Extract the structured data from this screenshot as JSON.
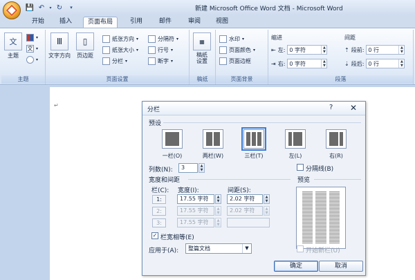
{
  "window": {
    "title": "新建 Microsoft Office Word 文档 - Microsoft Word"
  },
  "qat": {
    "icons": [
      "office-button-icon",
      "save-icon",
      "undo-icon",
      "redo-icon",
      "customize-qat-icon"
    ]
  },
  "tabs": [
    {
      "label": "开始",
      "active": false
    },
    {
      "label": "插入",
      "active": false
    },
    {
      "label": "页面布局",
      "active": true
    },
    {
      "label": "引用",
      "active": false
    },
    {
      "label": "邮件",
      "active": false
    },
    {
      "label": "审阅",
      "active": false
    },
    {
      "label": "视图",
      "active": false
    }
  ],
  "ribbon": {
    "theme_group": {
      "label": "主题",
      "theme_btn": "主题",
      "colors_icon": "■",
      "fonts_icon": "文",
      "effects_icon": "◉"
    },
    "page_setup": {
      "label": "页面设置",
      "text_direction": "文字方向",
      "margins": "页边距",
      "orientation": "纸张方向",
      "size": "纸张大小",
      "columns": "分栏",
      "breaks": "分隔符",
      "line_numbers": "行号",
      "hyphenation": "断字"
    },
    "manuscript": {
      "label": "稿纸",
      "btn": "稿纸\n设置"
    },
    "page_background": {
      "label": "页面背景",
      "watermark": "水印",
      "page_color": "页面颜色",
      "page_borders": "页面边框"
    },
    "paragraph": {
      "label": "段落",
      "indent_title": "缩进",
      "spacing_title": "间距",
      "indent_left_label": "左:",
      "indent_left_value": "0 字符",
      "indent_right_label": "右:",
      "indent_right_value": "0 字符",
      "spacing_before_label": "段前:",
      "spacing_before_value": "0 行",
      "spacing_after_label": "段后:",
      "spacing_after_value": "0 行"
    }
  },
  "dialog": {
    "title": "分栏",
    "help": "?",
    "close": "✕",
    "presets_label": "预设",
    "presets": [
      {
        "label": "一栏(O)",
        "cols": 1,
        "selected": false
      },
      {
        "label": "两栏(W)",
        "cols": 2,
        "selected": false
      },
      {
        "label": "三栏(T)",
        "cols": 3,
        "selected": true
      },
      {
        "label": "左(L)",
        "cols": 2,
        "selected": false
      },
      {
        "label": "右(R)",
        "cols": 2,
        "selected": false
      }
    ],
    "num_columns_label": "列数(N):",
    "num_columns_value": "3",
    "separator_label": "分隔线(B)",
    "width_spacing_label": "宽度和间距",
    "col_header": "栏(C):",
    "width_header": "宽度(I):",
    "spacing_header": "间距(S):",
    "preview_label": "预览",
    "rows": [
      {
        "num": "1:",
        "width": "17.55 字符",
        "spacing": "2.02 字符"
      },
      {
        "num": "2:",
        "width": "17.55 字符",
        "spacing": "2.02 字符"
      },
      {
        "num": "3:",
        "width": "17.55 字符",
        "spacing": ""
      }
    ],
    "equal_width_label": "栏宽相等(E)",
    "equal_width_checked": "✓",
    "apply_to_label": "应用于(A):",
    "apply_to_value": "整篇文档",
    "new_column_label": "开始新栏(U)",
    "ok": "确定",
    "cancel": "取消"
  },
  "document": {
    "paragraph_mark": "↵"
  }
}
